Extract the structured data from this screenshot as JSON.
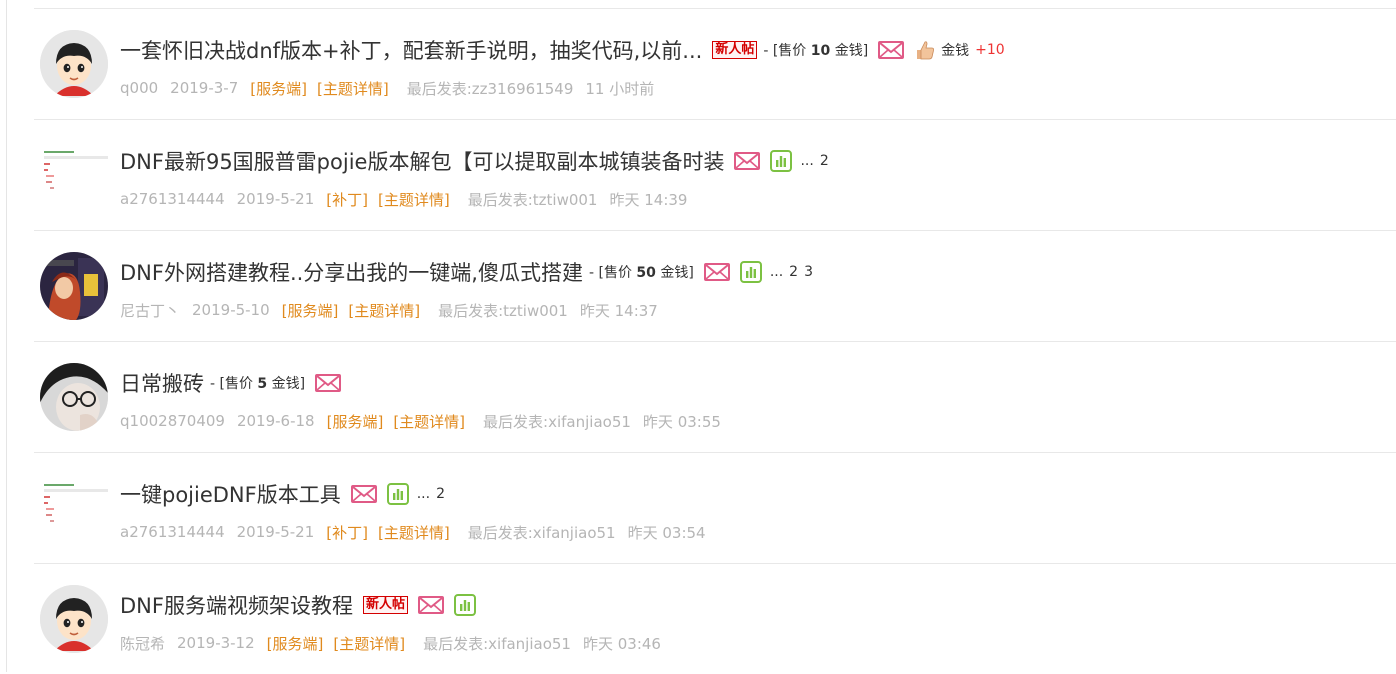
{
  "colors": {
    "accent_tag": "#e08a1e",
    "new_badge": "#d40000",
    "mail_icon": "#e05a86",
    "stat_icon": "#7cc142",
    "reward_plus": "#e33333"
  },
  "threads": [
    {
      "avatar": "cartoon-boy-avatar",
      "title": "一套怀旧决战dnf版本+补丁，配套新手说明，抽奖代码,以前...",
      "new_badge": "新人帖",
      "price_prefix": "- [售价 ",
      "price_value": "10",
      "price_suffix": " 金钱]",
      "reward_label": "金钱",
      "reward_value": "+10",
      "author": "q000",
      "date": "2019-3-7",
      "category": "[服务端]",
      "detail": "[主题详情]",
      "last_post": "最后发表:zz316961549",
      "last_time": "11 小时前"
    },
    {
      "avatar": "screenshot-thumbnail",
      "title": "DNF最新95国服普雷pojie版本解包【可以提取副本城镇装备时装",
      "pages_prefix": "...",
      "pages": [
        "2"
      ],
      "author": "a2761314444",
      "date": "2019-5-21",
      "category": "[补丁]",
      "detail": "[主题详情]",
      "last_post": "最后发表:tztiw001",
      "last_time": "昨天 14:39"
    },
    {
      "avatar": "game-character-avatar",
      "title": "DNF外网搭建教程..分享出我的一键端,傻瓜式搭建",
      "price_prefix": " - [售价 ",
      "price_value": "50",
      "price_suffix": " 金钱]",
      "pages_prefix": "...",
      "pages": [
        "2",
        "3"
      ],
      "author": "尼古丁丶",
      "date": "2019-5-10",
      "category": "[服务端]",
      "detail": "[主题详情]",
      "last_post": "最后发表:tztiw001",
      "last_time": "昨天 14:37"
    },
    {
      "avatar": "photo-avatar",
      "title": "日常搬砖",
      "price_prefix": " - [售价 ",
      "price_value": "5",
      "price_suffix": " 金钱]",
      "author": "q1002870409",
      "date": "2019-6-18",
      "category": "[服务端]",
      "detail": "[主题详情]",
      "last_post": "最后发表:xifanjiao51",
      "last_time": "昨天 03:55"
    },
    {
      "avatar": "screenshot-thumbnail",
      "title": "一键pojieDNF版本工具",
      "pages_prefix": "...",
      "pages": [
        "2"
      ],
      "author": "a2761314444",
      "date": "2019-5-21",
      "category": "[补丁]",
      "detail": "[主题详情]",
      "last_post": "最后发表:xifanjiao51",
      "last_time": "昨天 03:54"
    },
    {
      "avatar": "cartoon-boy-avatar",
      "title": "DNF服务端视频架设教程",
      "new_badge": "新人帖",
      "author": "陈冠希",
      "date": "2019-3-12",
      "category": "[服务端]",
      "detail": "[主题详情]",
      "last_post": "最后发表:xifanjiao51",
      "last_time": "昨天 03:46"
    }
  ]
}
